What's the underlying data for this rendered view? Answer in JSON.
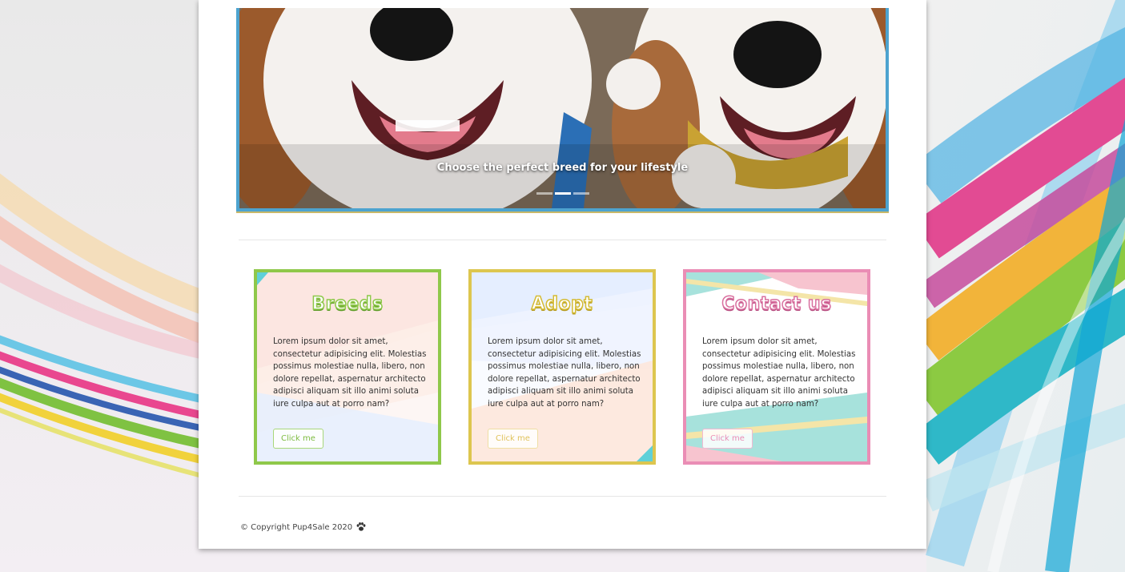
{
  "carousel": {
    "caption": "Choose the perfect breed for your lifestyle",
    "slides": 3,
    "active_slide": 2
  },
  "cards": [
    {
      "title": "Breeds",
      "text": "Lorem ipsum dolor sit amet, consectetur adipisicing elit. Molestias possimus molestiae nulla, libero, non dolore repellat, aspernatur architecto adipisci aliquam sit illo animi soluta iure culpa aut at porro nam?",
      "button": "Click me",
      "color": "#8fc84a"
    },
    {
      "title": "Adopt",
      "text": "Lorem ipsum dolor sit amet, consectetur adipisicing elit. Molestias possimus molestiae nulla, libero, non dolore repellat, aspernatur architecto adipisci aliquam sit illo animi soluta iure culpa aut at porro nam?",
      "button": "Click me",
      "color": "#ddc64f"
    },
    {
      "title": "Contact us",
      "text": "Lorem ipsum dolor sit amet, consectetur adipisicing elit. Molestias possimus molestiae nulla, libero, non dolore repellat, aspernatur architecto adipisci aliquam sit illo animi soluta iure culpa aut at porro nam?",
      "button": "Click me",
      "color": "#ea8db5"
    }
  ],
  "footer": {
    "copyright": "© Copyright Pup4Sale 2020",
    "icon": "paw-icon"
  },
  "colors": {
    "carousel_border": "#4da3cf"
  }
}
